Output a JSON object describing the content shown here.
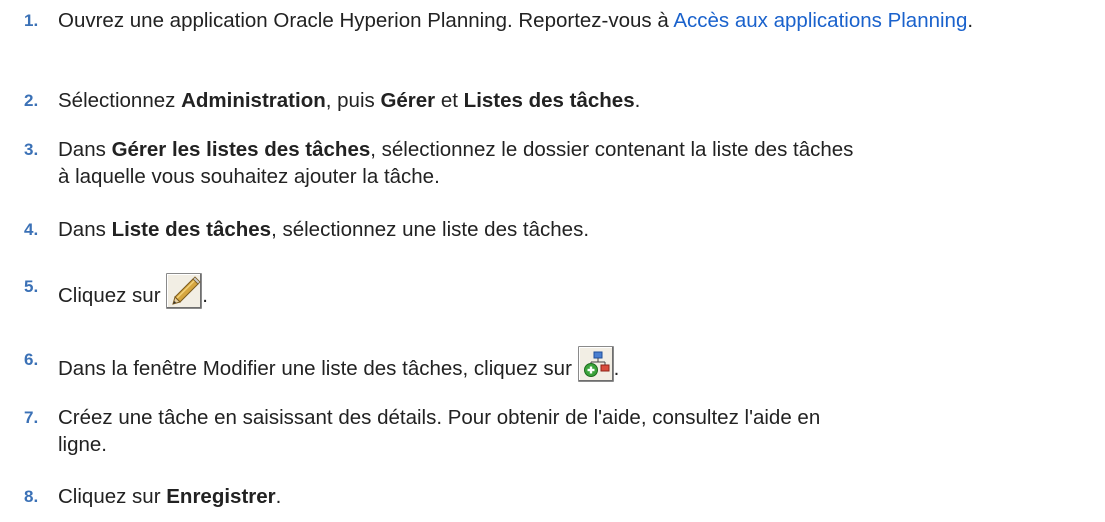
{
  "steps": [
    {
      "number": "1.",
      "text_before": "Ouvrez une application Oracle Hyperion Planning. Reportez-vous à ",
      "link_text": "Accès aux applications Planning",
      "text_after": "."
    },
    {
      "number": "2.",
      "t1": "Sélectionnez ",
      "b1": "Administration",
      "t2": ", puis ",
      "b2": "Gérer",
      "t3": " et ",
      "b3": "Listes des tâches",
      "t4": "."
    },
    {
      "number": "3.",
      "t1": "Dans ",
      "b1": "Gérer les listes des tâches",
      "t2": ", sélectionnez le dossier contenant la liste des tâches",
      "t3": "à laquelle vous souhaitez ajouter la tâche."
    },
    {
      "number": "4.",
      "t1": "Dans ",
      "b1": "Liste des tâches",
      "t2": ", sélectionnez une liste des tâches."
    },
    {
      "number": "5.",
      "t1": "Cliquez sur ",
      "icon": "pencil-edit-icon",
      "t2": "."
    },
    {
      "number": "6.",
      "t1": "Dans la fenêtre Modifier une liste des tâches, cliquez sur ",
      "icon": "add-task-hierarchy-icon",
      "t2": "."
    },
    {
      "number": "7.",
      "t1": "Créez une tâche en saisissant des détails. Pour obtenir de l'aide, consultez l'aide en",
      "t2": "ligne."
    },
    {
      "number": "8.",
      "t1": "Cliquez sur ",
      "b1": "Enregistrer",
      "t2": "."
    }
  ],
  "colors": {
    "step_number": "#3b71b6",
    "link": "#1a62cc",
    "text": "#222222"
  }
}
